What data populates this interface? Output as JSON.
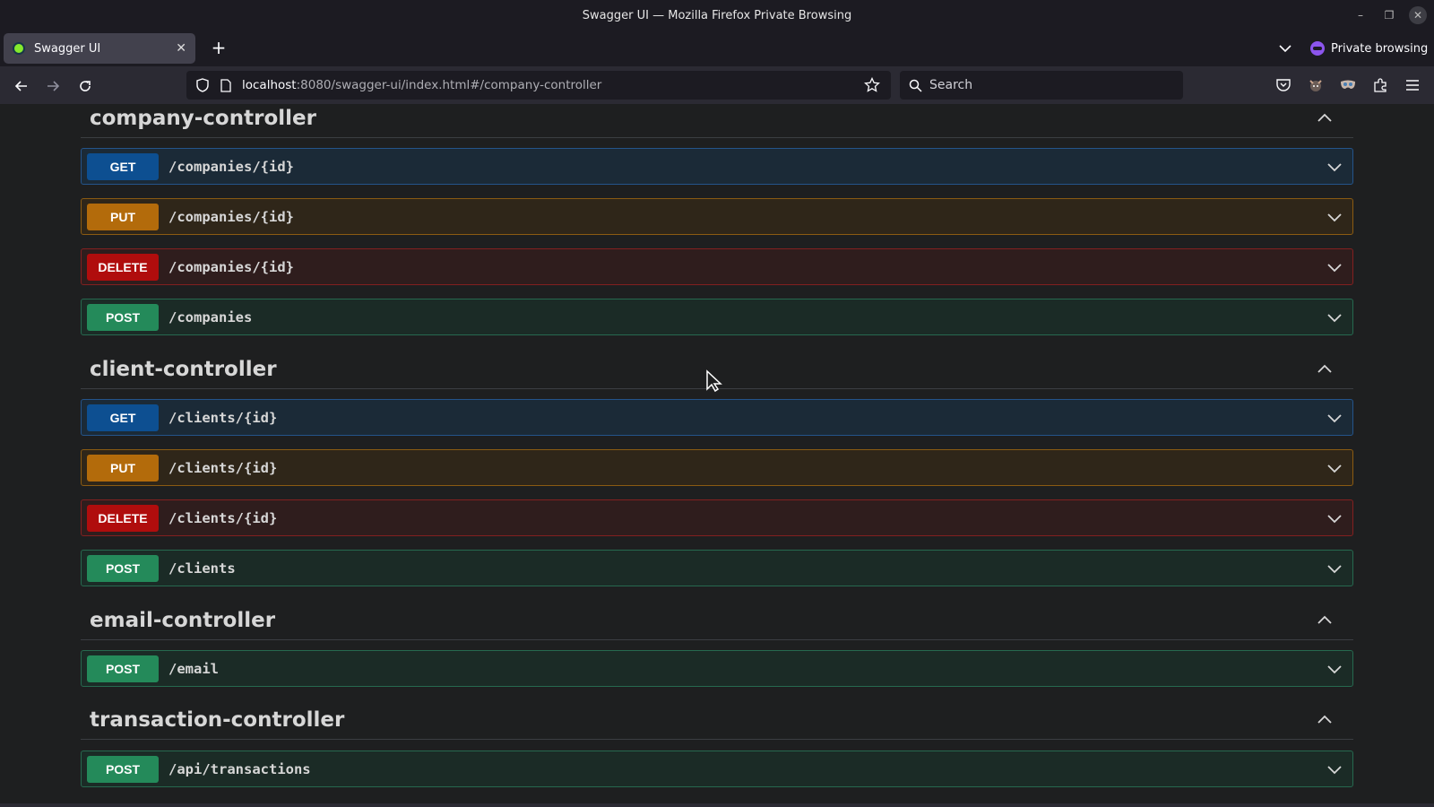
{
  "window": {
    "title": "Swagger UI — Mozilla Firefox Private Browsing"
  },
  "tabs": [
    {
      "label": "Swagger UI",
      "active": true
    }
  ],
  "private_browsing": {
    "label": "Private browsing"
  },
  "url": {
    "host": "localhost",
    "rest": ":8080/swagger-ui/index.html#/company-controller"
  },
  "search": {
    "placeholder": "Search"
  },
  "sections": [
    {
      "title": "company-controller",
      "operations": [
        {
          "method": "GET",
          "path": "/companies/{id}"
        },
        {
          "method": "PUT",
          "path": "/companies/{id}"
        },
        {
          "method": "DELETE",
          "path": "/companies/{id}"
        },
        {
          "method": "POST",
          "path": "/companies"
        }
      ]
    },
    {
      "title": "client-controller",
      "operations": [
        {
          "method": "GET",
          "path": "/clients/{id}"
        },
        {
          "method": "PUT",
          "path": "/clients/{id}"
        },
        {
          "method": "DELETE",
          "path": "/clients/{id}"
        },
        {
          "method": "POST",
          "path": "/clients"
        }
      ]
    },
    {
      "title": "email-controller",
      "operations": [
        {
          "method": "POST",
          "path": "/email"
        }
      ]
    },
    {
      "title": "transaction-controller",
      "operations": [
        {
          "method": "POST",
          "path": "/api/transactions"
        }
      ]
    }
  ],
  "colors": {
    "get": "#0d4f91",
    "put": "#b36b0b",
    "delete": "#b00d0d",
    "post": "#248a5a",
    "page_background": "#1e1f20"
  },
  "icons": {
    "back": "arrow-left-icon",
    "forward": "arrow-right-icon",
    "reload": "reload-icon",
    "bookmark": "star-icon",
    "pocket": "pocket-icon",
    "menu": "hamburger-menu-icon"
  }
}
